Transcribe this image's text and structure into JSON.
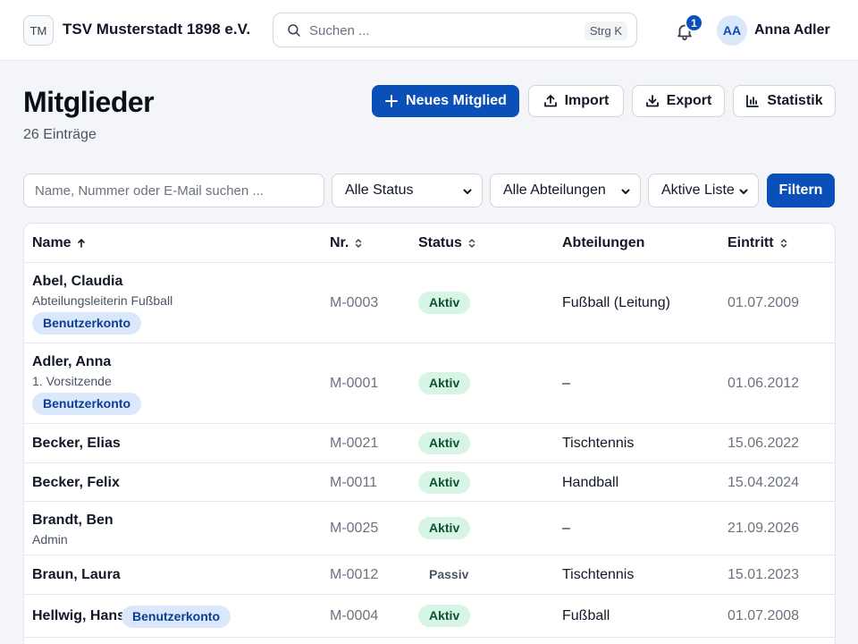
{
  "header": {
    "logo_initials": "TM",
    "club_name": "TSV Musterstadt 1898 e.V.",
    "search_placeholder": "Suchen ...",
    "search_shortcut": "Strg K",
    "notification_count": "1",
    "user_initials": "AA",
    "user_name": "Anna Adler"
  },
  "page": {
    "title": "Mitglieder",
    "count": "26 Einträge"
  },
  "actions": {
    "new_member": "Neues Mitglied",
    "import": "Import",
    "export": "Export",
    "stats": "Statistik"
  },
  "filters": {
    "search_placeholder": "Name, Nummer oder E-Mail suchen ...",
    "status_value": "Alle Status",
    "department_value": "Alle Abteilungen",
    "list_value": "Aktive Liste",
    "filter_button": "Filtern"
  },
  "table": {
    "columns": {
      "name": "Name",
      "number": "Nr.",
      "status": "Status",
      "departments": "Abteilungen",
      "joined": "Eintritt"
    },
    "rows": [
      {
        "name": "Abel, Claudia",
        "role": "Abteilungsleiterin Fußball",
        "account": "Benutzerkonto",
        "number": "M-0003",
        "status": "Aktiv",
        "departments": "Fußball (Leitung)",
        "joined": "01.07.2009"
      },
      {
        "name": "Adler, Anna",
        "role": "1. Vorsitzende",
        "account": "Benutzerkonto",
        "number": "M-0001",
        "status": "Aktiv",
        "departments": "–",
        "joined": "01.06.2012"
      },
      {
        "name": "Becker, Elias",
        "number": "M-0021",
        "status": "Aktiv",
        "departments": "Tischtennis",
        "joined": "15.06.2022"
      },
      {
        "name": "Becker, Felix",
        "number": "M-0011",
        "status": "Aktiv",
        "departments": "Handball",
        "joined": "15.04.2024"
      },
      {
        "name": "Brandt, Ben",
        "role": "Admin",
        "number": "M-0025",
        "status": "Aktiv",
        "departments": "–",
        "joined": "21.09.2026"
      },
      {
        "name": "Braun, Laura",
        "number": "M-0012",
        "status": "Passiv",
        "departments": "Tischtennis",
        "joined": "15.01.2023"
      },
      {
        "name": "Hellwig, Hans",
        "account": "Benutzerkonto",
        "number": "M-0004",
        "status": "Aktiv",
        "departments": "Fußball",
        "joined": "01.07.2008"
      }
    ]
  },
  "colors": {
    "primary": "#0b4fb8",
    "active_bg": "#d7f5e4",
    "account_badge_bg": "#dbe7fb"
  },
  "icons": {
    "search": "search-icon",
    "bell": "bell-icon",
    "plus": "plus-icon",
    "import": "upload-icon",
    "export": "download-icon",
    "stats": "bar-chart-icon"
  }
}
